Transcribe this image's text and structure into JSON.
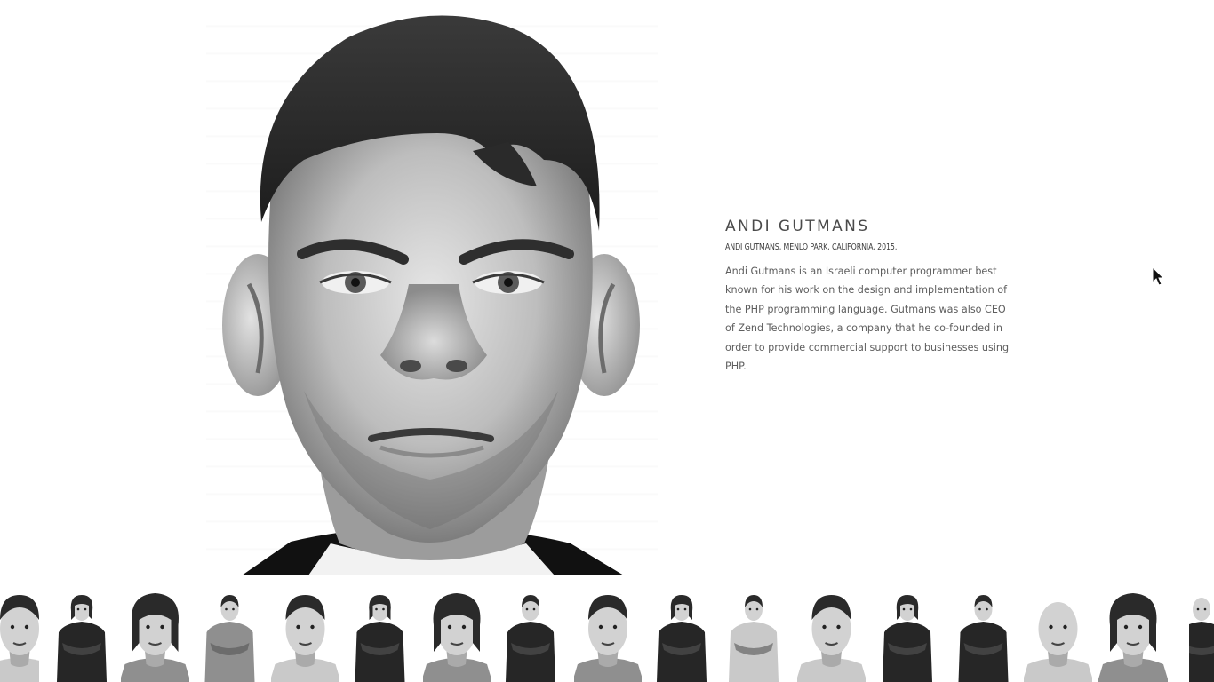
{
  "profile": {
    "name": "ANDI GUTMANS",
    "caption": "ANDI GUTMANS, MENLO PARK, CALIFORNIA, 2015.",
    "bio": "Andi Gutmans is an Israeli computer programmer best known for his work on the design and implementation of the PHP programming language. Gutmans was also CEO of Zend Technologies, a company that he co-founded in order to provide commercial support to businesses using PHP."
  },
  "main_portrait": {
    "subject": "Andi Gutmans",
    "style": "black-and-white close-up"
  },
  "thumbnails": [
    {
      "subject": "portrait-partial-left",
      "shot": "close",
      "tone": "light",
      "hair": "short"
    },
    {
      "subject": "man-long-hair-patterned-shirt",
      "shot": "full",
      "tone": "dark",
      "hair": "long"
    },
    {
      "subject": "man-long-hair-smiling",
      "shot": "close",
      "tone": "mid",
      "hair": "long"
    },
    {
      "subject": "man-gray-hair-arms-crossed",
      "shot": "full",
      "tone": "mid",
      "hair": "short"
    },
    {
      "subject": "man-gray-hair-close",
      "shot": "close",
      "tone": "light",
      "hair": "short"
    },
    {
      "subject": "woman-glasses-dark-jacket",
      "shot": "full",
      "tone": "dark",
      "hair": "long"
    },
    {
      "subject": "woman-glasses-close",
      "shot": "close",
      "tone": "mid",
      "hair": "long"
    },
    {
      "subject": "man-short-hair-holding-object",
      "shot": "full",
      "tone": "dark",
      "hair": "short"
    },
    {
      "subject": "andi-gutmans-close",
      "shot": "close",
      "tone": "mid",
      "hair": "short"
    },
    {
      "subject": "man-curly-hair",
      "shot": "full",
      "tone": "dark",
      "hair": "long"
    },
    {
      "subject": "man-cap-full-length",
      "shot": "full",
      "tone": "light",
      "hair": "short"
    },
    {
      "subject": "man-beard-close",
      "shot": "close",
      "tone": "light",
      "hair": "short"
    },
    {
      "subject": "woman-dotted-dress",
      "shot": "full",
      "tone": "dark",
      "hair": "long"
    },
    {
      "subject": "woman-polka-dot-blouse",
      "shot": "full",
      "tone": "dark",
      "hair": "short"
    },
    {
      "subject": "older-man-glasses-close",
      "shot": "close",
      "tone": "light",
      "hair": "bald"
    },
    {
      "subject": "woman-glasses-dark-hair-close",
      "shot": "close",
      "tone": "mid",
      "hair": "long"
    },
    {
      "subject": "man-partial-right",
      "shot": "full",
      "tone": "dark",
      "hair": "bald"
    }
  ],
  "colors": {
    "background": "#ffffff",
    "name_text": "#4a4a4a",
    "caption_text": "#3c3c3c",
    "body_text": "#5e5e5e"
  },
  "icons": [
    "cursor-arrow-icon"
  ]
}
